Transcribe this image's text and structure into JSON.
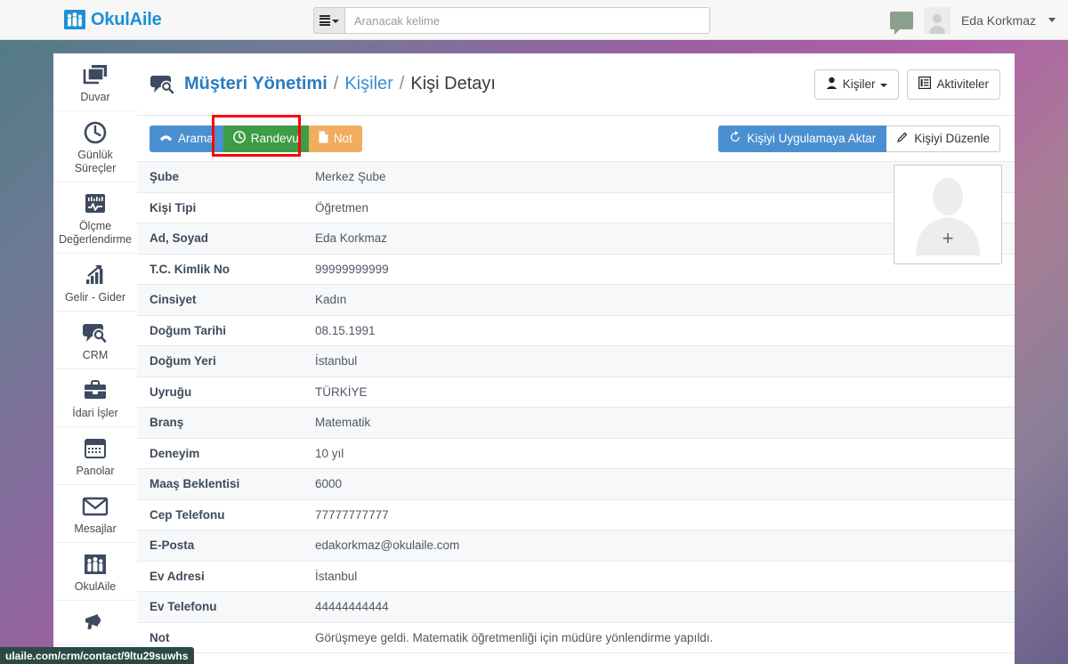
{
  "navbar": {
    "brand": "OkulAile",
    "brand_icon": "family-house-icon",
    "search": {
      "placeholder": "Aranacak kelime",
      "value": "",
      "dropdown_icon": "hamburger-caret-icon"
    },
    "chat_icon": "chat-bubble-icon",
    "user": {
      "name": "Eda Korkmaz",
      "avatar_icon": "user-avatar-icon",
      "caret_icon": "caret-down-icon"
    }
  },
  "sidebar": {
    "items": [
      {
        "label": "Duvar",
        "icon": "layers-icon"
      },
      {
        "label": "Günlük",
        "label2": "Süreçler",
        "icon": "clock-icon"
      },
      {
        "label": "Ölçme",
        "label2": "Değerlendirme",
        "icon": "pulse-monitor-icon"
      },
      {
        "label": "Gelir - Gider",
        "icon": "bar-chart-arrow-icon"
      },
      {
        "label": "CRM",
        "icon": "speech-search-icon"
      },
      {
        "label": "İdari İşler",
        "icon": "briefcase-icon"
      },
      {
        "label": "Panolar",
        "icon": "calendar-grid-icon"
      },
      {
        "label": "Mesajlar",
        "icon": "envelope-icon"
      },
      {
        "label": "OkulAile",
        "icon": "family-icon"
      },
      {
        "label": "",
        "icon": "megaphone-icon"
      }
    ]
  },
  "page_head": {
    "breadcrumb_icon": "speech-search-icon",
    "breadcrumb": [
      {
        "text": "Müşteri Yönetimi",
        "style": "primary"
      },
      {
        "text": "/",
        "style": "sep"
      },
      {
        "text": "Kişiler",
        "style": "link"
      },
      {
        "text": "/",
        "style": "sep"
      },
      {
        "text": "Kişi Detayı",
        "style": "current"
      }
    ],
    "buttons": [
      {
        "label": "Kişiler",
        "icon": "person-icon",
        "caret": true
      },
      {
        "label": "Aktiviteler",
        "icon": "list-panel-icon",
        "caret": false
      }
    ]
  },
  "action_bar": {
    "left_buttons": [
      {
        "label": "Arama",
        "icon": "phone-icon",
        "color": "#4a90d0"
      },
      {
        "label": "Randevu",
        "icon": "clock-icon",
        "color": "#3d9c45",
        "highlighted": true
      },
      {
        "label": "Not",
        "icon": "file-icon",
        "color": "#f0ad5e"
      }
    ],
    "right_buttons": [
      {
        "label": "Kişiyi Uygulamaya Aktar",
        "icon": "refresh-icon",
        "color": "#4a90d0"
      },
      {
        "label": "Kişiyi Düzenle",
        "icon": "edit-pencil-icon",
        "color": "#ffffff"
      }
    ],
    "highlight_color": "#ff0000"
  },
  "detail": {
    "rows": [
      {
        "label": "Şube",
        "value": "Merkez Şube"
      },
      {
        "label": "Kişi Tipi",
        "value": "Öğretmen"
      },
      {
        "label": "Ad, Soyad",
        "value": "Eda Korkmaz"
      },
      {
        "label": "T.C. Kimlik No",
        "value": "99999999999"
      },
      {
        "label": "Cinsiyet",
        "value": "Kadın"
      },
      {
        "label": "Doğum Tarihi",
        "value": "08.15.1991"
      },
      {
        "label": "Doğum Yeri",
        "value": "İstanbul"
      },
      {
        "label": "Uyruğu",
        "value": "TÜRKİYE"
      },
      {
        "label": "Branş",
        "value": "Matematik"
      },
      {
        "label": "Deneyim",
        "value": "10 yıl"
      },
      {
        "label": "Maaş Beklentisi",
        "value": "6000"
      },
      {
        "label": "Cep Telefonu",
        "value": "77777777777"
      },
      {
        "label": "E-Posta",
        "value": "edakorkmaz@okulaile.com"
      },
      {
        "label": "Ev Adresi",
        "value": "İstanbul"
      },
      {
        "label": "Ev Telefonu",
        "value": "44444444444"
      },
      {
        "label": "Not",
        "value": "Görüşmeye geldi. Matematik öğretmenliği için müdüre yönlendirme yapıldı."
      }
    ],
    "photo": {
      "icon": "user-silhouette-icon",
      "add_symbol": "+"
    }
  },
  "status_bar": {
    "url": "ulaile.com/crm/contact/9ltu29suwhs"
  }
}
